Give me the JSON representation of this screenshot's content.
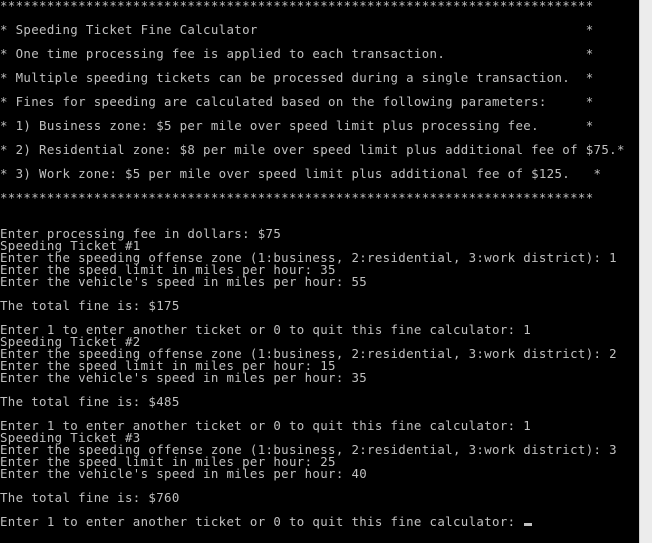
{
  "colors": {
    "background": "#000000",
    "text": "#c0c0c0",
    "scrollbar": "#ececec"
  },
  "console": {
    "lines": [
      "****************************************************************************",
      "* Speeding Ticket Fine Calculator                                          *",
      "* One time processing fee is applied to each transaction.                  *",
      "* Multiple speeding tickets can be processed during a single transaction.  *",
      "* Fines for speeding are calculated based on the following parameters:     *",
      "* 1) Business zone: $5 per mile over speed limit plus processing fee.      *",
      "* 2) Residential zone: $8 per mile over speed limit plus additional fee of $75.*",
      "* 3) Work zone: $5 per mile over speed limit plus additional fee of $125.   *",
      "****************************************************************************",
      "Enter processing fee in dollars: $75",
      "Speeding Ticket #1",
      "Enter the speeding offense zone (1:business, 2:residential, 3:work district): 1",
      "Enter the speed limit in miles per hour: 35",
      "Enter the vehicle's speed in miles per hour: 55",
      "The total fine is: $175",
      "Enter 1 to enter another ticket or 0 to quit this fine calculator: 1",
      "Speeding Ticket #2",
      "Enter the speeding offense zone (1:business, 2:residential, 3:work district): 2",
      "Enter the speed limit in miles per hour: 15",
      "Enter the vehicle's speed in miles per hour: 35",
      "The total fine is: $485",
      "Enter 1 to enter another ticket or 0 to quit this fine calculator: 1",
      "Speeding Ticket #3",
      "Enter the speeding offense zone (1:business, 2:residential, 3:work district): 3",
      "Enter the speed limit in miles per hour: 25",
      "Enter the vehicle's speed in miles per hour: 40",
      "The total fine is: $760",
      "Enter 1 to enter another ticket or 0 to quit this fine calculator: "
    ]
  }
}
